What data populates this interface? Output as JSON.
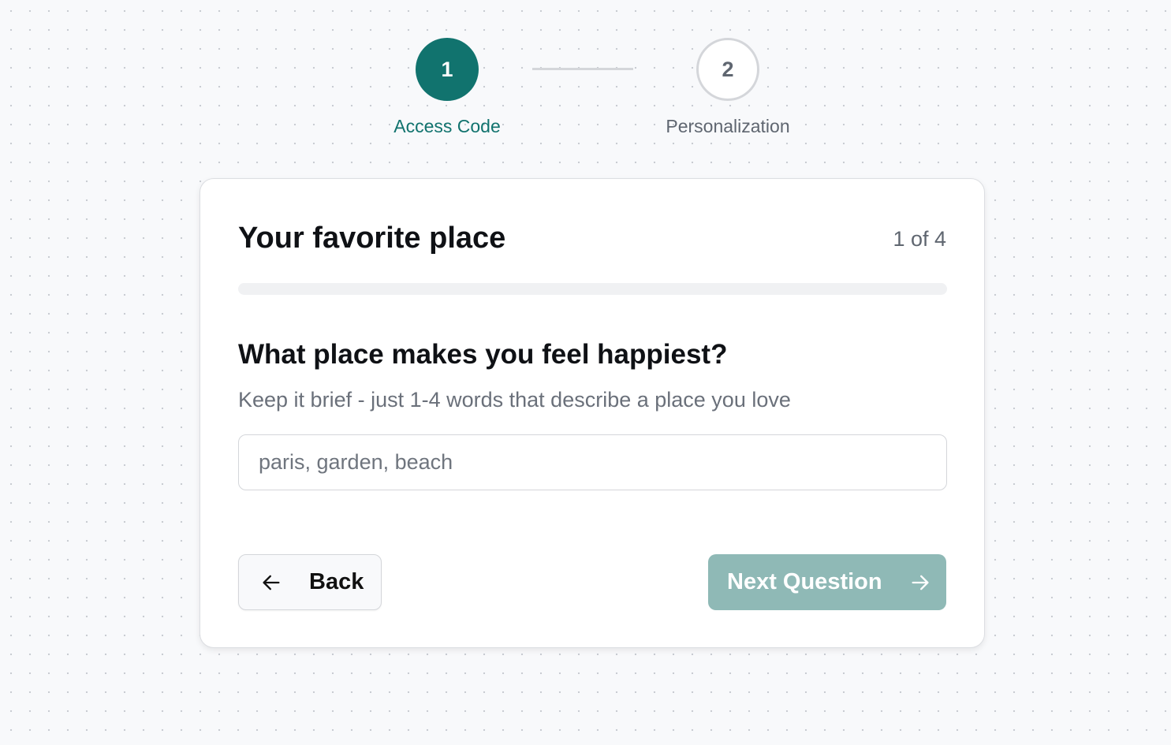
{
  "stepper": {
    "steps": [
      {
        "number": "1",
        "label": "Access Code",
        "state": "active"
      },
      {
        "number": "2",
        "label": "Personalization",
        "state": "inactive"
      }
    ]
  },
  "card": {
    "title": "Your favorite place",
    "counter": "1 of 4",
    "progress_percent": 0,
    "question": "What place makes you feel happiest?",
    "hint": "Keep it brief - just 1-4 words that describe a place you love",
    "input": {
      "value": "",
      "placeholder": "paris, garden, beach"
    },
    "back_button": {
      "label": "Back",
      "icon": "arrow-left-icon"
    },
    "next_button": {
      "label": "Next Question",
      "icon": "arrow-right-icon",
      "disabled": true
    }
  },
  "colors": {
    "accent": "#11736e",
    "accent_disabled": "#8fb9b6",
    "muted_text": "#5f6670",
    "border": "#d4d6da",
    "background": "#f8f9fb"
  }
}
